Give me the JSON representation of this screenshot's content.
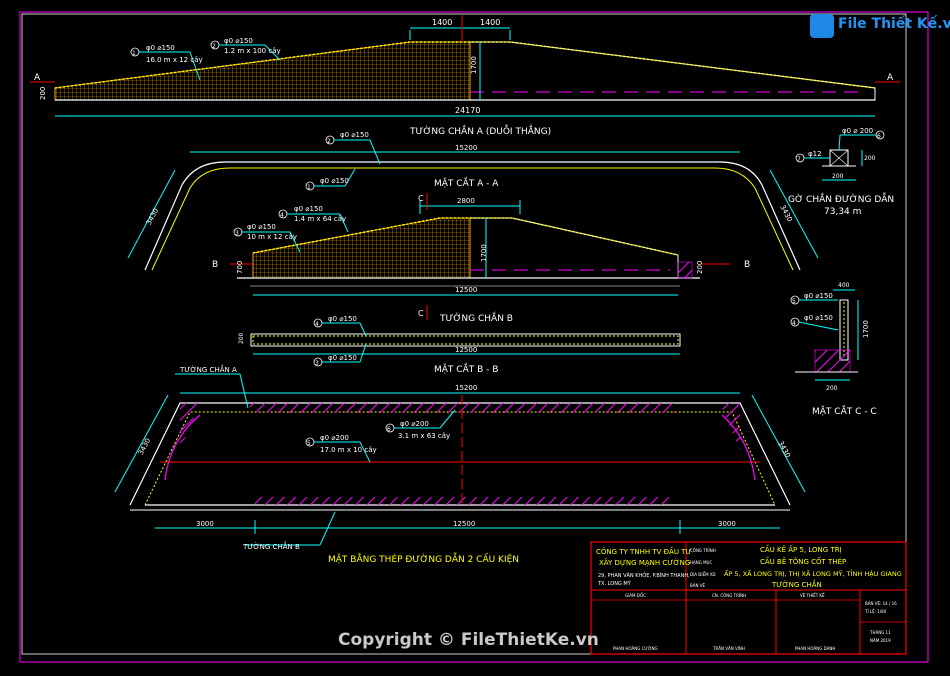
{
  "drawing": {
    "top_dims": {
      "d1400a": "1400",
      "d1400b": "1400",
      "d1700": "1700",
      "d200": "200",
      "d24170": "24170"
    },
    "marks_a": {
      "left": "A",
      "right": "A"
    },
    "bar_labels_top": {
      "b1": "φ0 ⌀150",
      "b1n": "16.0 m x 12 cây",
      "b2": "φ0 ⌀150",
      "b2n": "1.2 m x 100 cây",
      "n1": "1",
      "n2": "2"
    },
    "title_wall_a": "TƯỜNG CHẮN A (DUỖI THẲNG)",
    "section_aa": {
      "d15200": "15200",
      "d3430l": "3430",
      "d3430r": "3430",
      "b2": "φ0 ⌀150",
      "b1": "φ0 ⌀150",
      "n1": "1",
      "n2": "2",
      "title": "MẶT CẮT A - A"
    },
    "curb": {
      "title": "GỜ CHẮN ĐƯỜNG DẪN",
      "length": "73,34 m",
      "bar6": "φ0 ⌀ 200",
      "bar7": "φ12",
      "d200a": "200",
      "d200b": "200",
      "n6": "6",
      "n7": "7"
    },
    "mid_dims": {
      "d2800": "2800",
      "d1700": "1700",
      "d700": "700",
      "d12500": "12500",
      "d200": "200",
      "c_top": "C",
      "c_bot": "C"
    },
    "marks_b": {
      "left": "B",
      "right": "B"
    },
    "bar_labels_mid": {
      "b4": "φ0 ⌀150",
      "b4n": "1.4 m x 64 cây",
      "b3": "φ0 ⌀150",
      "b3n": "10 m x 12 cây",
      "n3": "3",
      "n4": "4"
    },
    "title_wall_b": "TƯỜNG CHẮN B",
    "section_bb": {
      "d200": "200",
      "b4": "φ0 ⌀150",
      "b3": "φ0 ⌀150",
      "n4": "4",
      "n3": "3",
      "d12500": "12500",
      "title": "MẶT CẮT B - B"
    },
    "section_cc": {
      "d400": "400",
      "d1700": "1700",
      "d200": "200",
      "b5": "φ0 ⌀150",
      "b4": "φ0 ⌀150",
      "n5": "5",
      "n4": "4",
      "title": "MẶT CẮT C - C"
    },
    "plan": {
      "wall_a": "TƯỜNG CHẮN A",
      "wall_b": "TƯỜNG CHẮN B",
      "d15200": "15200",
      "d3430l": "3430",
      "d3430r": "3430",
      "b5": "φ0 ⌀200",
      "b5n": "17.0 m x 10 cây",
      "b6": "φ0 ⌀200",
      "b6n": "3.1 m x 63 cây",
      "n5": "5",
      "n6": "6",
      "d3000l": "3000",
      "d12500": "12500",
      "d3000r": "3000",
      "title": "MẶT BẰNG THÉP ĐƯỜNG DẪN 2 CẤU KIỆN"
    }
  },
  "title_block": {
    "company": "CÔNG TY TNHH TV ĐẦU TƯ",
    "company2": "XÂY DỰNG MẠNH CƯỜNG",
    "address": "29, PHAN VĂN KHỎE, P.BÌNH THẠNH,",
    "address2": "TX. LONG MỸ",
    "lbl_project": "CÔNG TRÌNH",
    "lbl_item": "HẠNG MỤC",
    "lbl_location": "ĐỊA ĐIỂM XD",
    "lbl_drawing": "BẢN VẼ",
    "project": "CẦU KÊ ẤP 5, LONG TRỊ",
    "item": "CẦU BÊ TÔNG CỐT THÉP",
    "location": "ẤP 5, XÃ LONG TRỊ, THỊ XÃ LONG MỸ, TỈNH HẬU GIANG",
    "drawing": "TƯỜNG CHẮN",
    "director": "GIÁM ĐỐC",
    "chief": "CN. CÔNG TRÌNH",
    "designer": "VẼ THIẾT KẾ",
    "sheet": "BẢN VẼ: 14 / 16",
    "scale": "TỈ LỆ: 1/80",
    "director_name": "PHAN HOÀNG CƯỜNG",
    "chief_name": "TRẦN VĂN VINH",
    "designer_name": "PHAN HOÀNG DANH",
    "date": "THÁNG 11",
    "year": "NĂM 2019"
  },
  "watermark": {
    "brand": "File Thiết Kế.vn",
    "copyright": "Copyright © FileThietKe.vn"
  },
  "colors": {
    "bg": "#000000",
    "line_white": "#ffffff",
    "cyan": "#00ffff",
    "yellow": "#ffff00",
    "red": "#ff0000",
    "magenta": "#ff00ff",
    "orange": "#ffaa00"
  }
}
